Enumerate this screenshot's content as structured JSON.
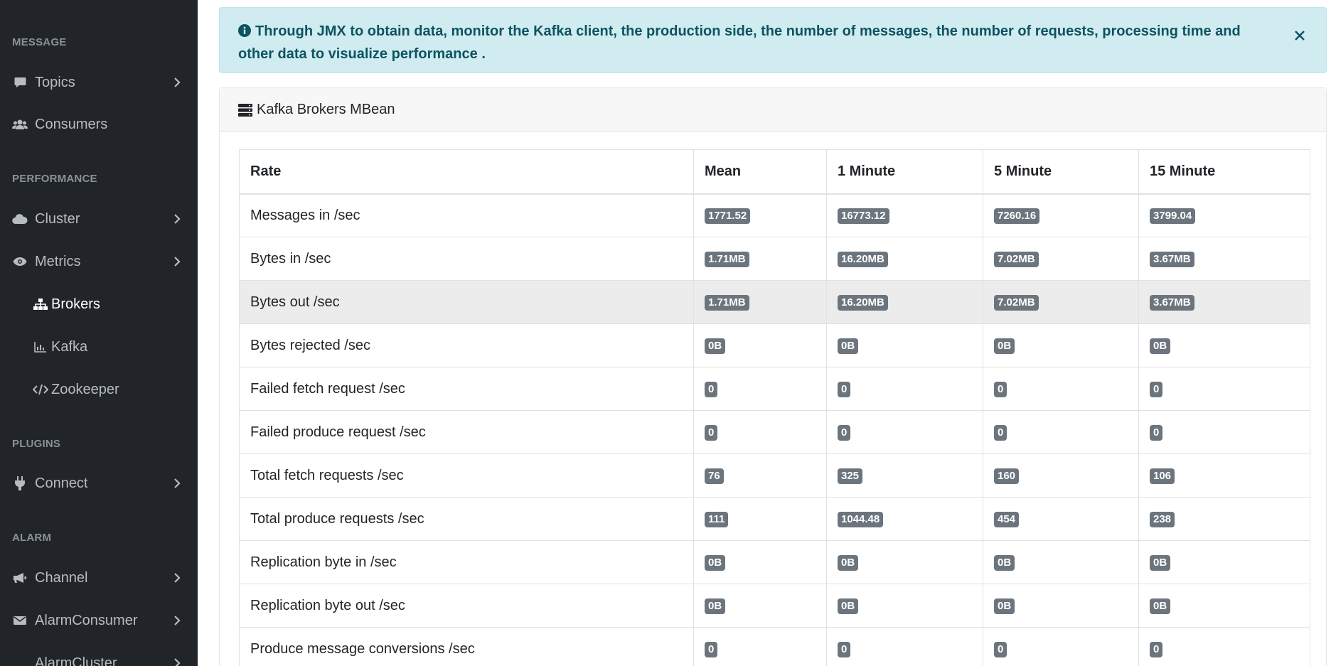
{
  "sidebar": {
    "sections": [
      {
        "heading": "MESSAGE"
      },
      {
        "heading": "PERFORMANCE"
      },
      {
        "heading": "PLUGINS"
      },
      {
        "heading": "ALARM"
      }
    ],
    "items": {
      "topics": "Topics",
      "consumers": "Consumers",
      "cluster": "Cluster",
      "metrics": "Metrics",
      "brokers": "Brokers",
      "kafka": "Kafka",
      "zookeeper": "Zookeeper",
      "connect": "Connect",
      "channel": "Channel",
      "alarm_consumer": "AlarmConsumer",
      "alarm_cluster": "AlarmCluster"
    },
    "icons": {
      "topics": "comment-icon",
      "consumers": "users-icon",
      "cluster": "cloud-icon",
      "metrics": "eye-icon",
      "brokers": "sitemap-icon",
      "kafka": "area-chart-icon",
      "zookeeper": "code-icon",
      "connect": "plug-icon",
      "channel": "bullhorn-icon",
      "alarm_consumer": "envelope-icon"
    },
    "colors": {
      "background": "#212529",
      "text": "#b7bcc1",
      "active": "#ffffff"
    }
  },
  "alert": {
    "text": "Through JMX to obtain data, monitor the Kafka client, the production side, the number of messages, the number of requests, processing time and other data to visualize performance .",
    "icon": "info-circle-icon",
    "close_icon": "close-icon",
    "colors": {
      "background": "#d1ecf1",
      "text": "#0c5460"
    }
  },
  "card": {
    "title": "Kafka Brokers MBean",
    "icon": "server-icon"
  },
  "table": {
    "headers": [
      "Rate",
      "Mean",
      "1 Minute",
      "5 Minute",
      "15 Minute"
    ],
    "rows": [
      {
        "rate": "Messages in /sec",
        "mean": "1771.52",
        "m1": "16773.12",
        "m5": "7260.16",
        "m15": "3799.04"
      },
      {
        "rate": "Bytes in /sec",
        "mean": "1.71MB",
        "m1": "16.20MB",
        "m5": "7.02MB",
        "m15": "3.67MB"
      },
      {
        "rate": "Bytes out /sec",
        "mean": "1.71MB",
        "m1": "16.20MB",
        "m5": "7.02MB",
        "m15": "3.67MB"
      },
      {
        "rate": "Bytes rejected /sec",
        "mean": "0B",
        "m1": "0B",
        "m5": "0B",
        "m15": "0B"
      },
      {
        "rate": "Failed fetch request /sec",
        "mean": "0",
        "m1": "0",
        "m5": "0",
        "m15": "0"
      },
      {
        "rate": "Failed produce request /sec",
        "mean": "0",
        "m1": "0",
        "m5": "0",
        "m15": "0"
      },
      {
        "rate": "Total fetch requests /sec",
        "mean": "76",
        "m1": "325",
        "m5": "160",
        "m15": "106"
      },
      {
        "rate": "Total produce requests /sec",
        "mean": "111",
        "m1": "1044.48",
        "m5": "454",
        "m15": "238"
      },
      {
        "rate": "Replication byte in /sec",
        "mean": "0B",
        "m1": "0B",
        "m5": "0B",
        "m15": "0B"
      },
      {
        "rate": "Replication byte out /sec",
        "mean": "0B",
        "m1": "0B",
        "m5": "0B",
        "m15": "0B"
      },
      {
        "rate": "Produce message conversions /sec",
        "mean": "0",
        "m1": "0",
        "m5": "0",
        "m15": "0"
      }
    ],
    "colors": {
      "badge": "#6c757d",
      "highlight_row": "#ececec"
    }
  }
}
